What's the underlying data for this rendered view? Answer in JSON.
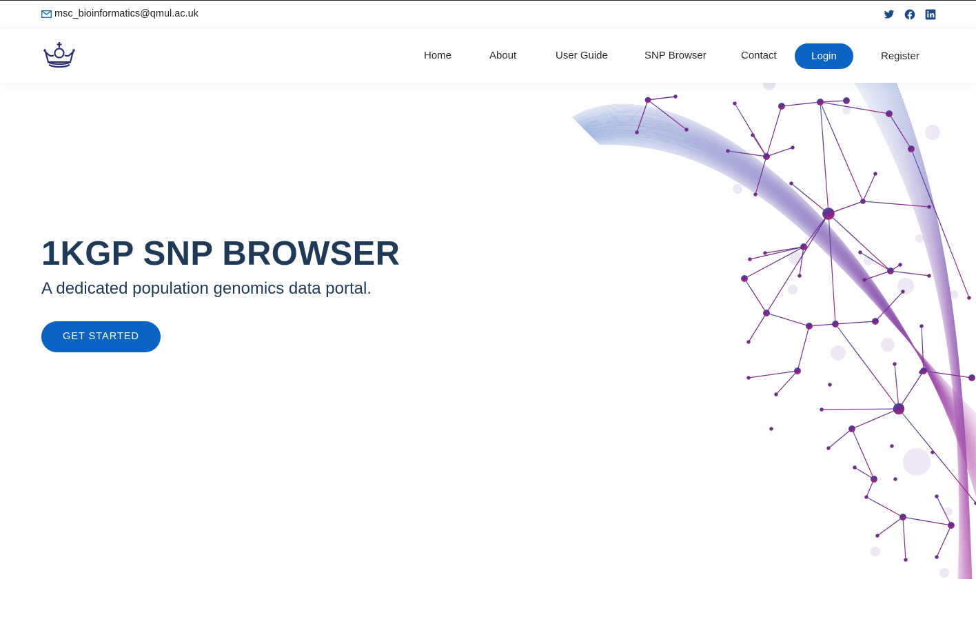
{
  "topbar": {
    "email": "msc_bioinformatics@qmul.ac.uk",
    "email_icon": "envelope-icon",
    "social_icons": [
      "twitter-icon",
      "facebook-icon",
      "linkedin-icon"
    ]
  },
  "nav": {
    "logo_icon": "crown-logo-icon",
    "items": [
      {
        "label": "Home"
      },
      {
        "label": "About"
      },
      {
        "label": "User Guide"
      },
      {
        "label": "SNP Browser"
      },
      {
        "label": "Contact"
      }
    ],
    "login_label": "Login",
    "register_label": "Register"
  },
  "hero": {
    "title": "1KGP SNP BROWSER",
    "subtitle": "A dedicated population genomics data portal.",
    "cta_label": "GET STARTED",
    "art_icon": "molecular-network-illustration"
  },
  "colors": {
    "primary_blue": "#0b63c4",
    "heading_navy": "#1e3a56",
    "network_start": "#4a68b8",
    "network_mid": "#5b2d8e",
    "network_end": "#9b2a8a"
  }
}
